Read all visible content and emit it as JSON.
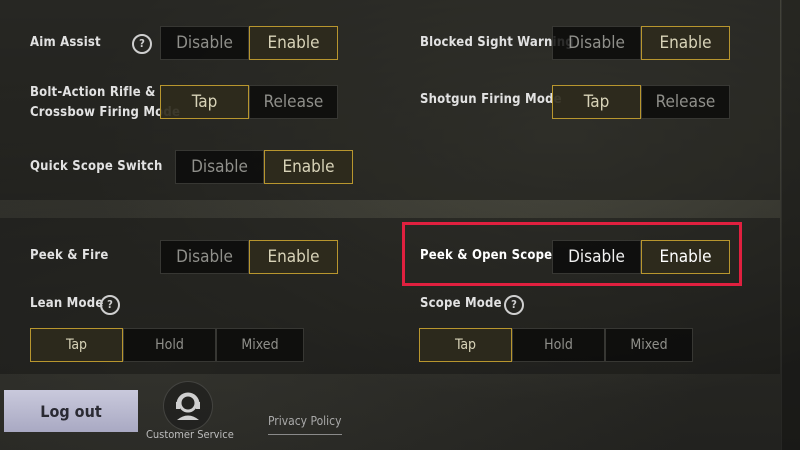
{
  "section_top": {
    "aim_assist": {
      "label": "Aim Assist",
      "options": [
        "Disable",
        "Enable"
      ],
      "selected": "Enable"
    },
    "blocked_sight_warning": {
      "label": "Blocked Sight Warning",
      "options": [
        "Disable",
        "Enable"
      ],
      "selected": "Enable"
    },
    "bolt_action_mode": {
      "label_line1": "Bolt-Action Rifle &",
      "label_line2": "Crossbow Firing Mode",
      "options": [
        "Tap",
        "Release"
      ],
      "selected": "Tap"
    },
    "shotgun_firing_mode": {
      "label": "Shotgun Firing Mode",
      "options": [
        "Tap",
        "Release"
      ],
      "selected": "Tap"
    },
    "quick_scope_switch": {
      "label": "Quick Scope Switch",
      "options": [
        "Disable",
        "Enable"
      ],
      "selected": "Enable"
    }
  },
  "section_bottom": {
    "peek_fire": {
      "label": "Peek & Fire",
      "options": [
        "Disable",
        "Enable"
      ],
      "selected": "Enable"
    },
    "peek_open_scope": {
      "label": "Peek & Open Scope",
      "options": [
        "Disable",
        "Enable"
      ],
      "selected": "Enable"
    },
    "lean_mode": {
      "label": "Lean Mode",
      "options": [
        "Tap",
        "Hold",
        "Mixed"
      ],
      "selected": "Tap"
    },
    "scope_mode": {
      "label": "Scope Mode",
      "options": [
        "Tap",
        "Hold",
        "Mixed"
      ],
      "selected": "Tap"
    }
  },
  "footer": {
    "logout_label": "Log out",
    "customer_service_label": "Customer Service",
    "privacy_policy_label": "Privacy Policy"
  },
  "icons": {
    "help": "question-circle-icon",
    "customer_service": "headset-agent-icon"
  },
  "colors": {
    "selected_border": "#b8962e",
    "highlight_border": "#e0203f"
  }
}
